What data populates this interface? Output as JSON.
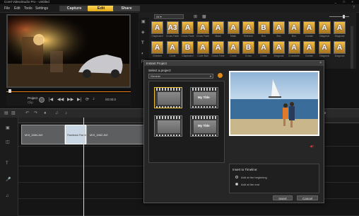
{
  "window": {
    "title": "Corel VideoStudio Pro - Untitled",
    "controls": "_ □ ×"
  },
  "menu": {
    "items": [
      "File",
      "Edit",
      "Tools",
      "Settings"
    ]
  },
  "steps": {
    "capture": "Capture",
    "edit": "Edit",
    "share": "Share"
  },
  "preview": {
    "project_label": "Project",
    "clip_label": "Clip",
    "timecode": "00:00:0"
  },
  "library": {
    "filter": "All",
    "thumbs": [
      {
        "label": "Clapboard",
        "glyph": "A"
      },
      {
        "label": "Cross Fade",
        "glyph": "A3"
      },
      {
        "label": "Cross Fade",
        "glyph": "A"
      },
      {
        "label": "Cross Fade",
        "glyph": "A"
      },
      {
        "label": "Mask",
        "glyph": "A"
      },
      {
        "label": "Mask",
        "glyph": "A"
      },
      {
        "label": "Retrieve",
        "glyph": "A"
      },
      {
        "label": "Box",
        "glyph": "B"
      },
      {
        "label": "Box",
        "glyph": "A"
      },
      {
        "label": "Box",
        "glyph": "A"
      },
      {
        "label": "Curtain",
        "glyph": "A"
      },
      {
        "label": "Diagonal",
        "glyph": "A"
      },
      {
        "label": "Diagonal",
        "glyph": "A"
      },
      {
        "label": "Checker",
        "glyph": "A"
      },
      {
        "label": "Circle",
        "glyph": "A"
      },
      {
        "label": "Clapboard",
        "glyph": "B"
      },
      {
        "label": "Cube Ball",
        "glyph": "A"
      },
      {
        "label": "Cross Fade",
        "glyph": "A"
      },
      {
        "label": "Cross",
        "glyph": "A"
      },
      {
        "label": "Cross",
        "glyph": "B"
      },
      {
        "label": "Cross",
        "glyph": "A"
      },
      {
        "label": "Diagonal",
        "glyph": "A"
      },
      {
        "label": "Crossfade",
        "glyph": "A"
      },
      {
        "label": "Curtain",
        "glyph": "A"
      },
      {
        "label": "Diagonal",
        "glyph": "A"
      },
      {
        "label": "Diagonal",
        "glyph": "A"
      },
      {
        "label": "",
        "glyph": "A"
      },
      {
        "label": "",
        "glyph": "B"
      },
      {
        "label": "",
        "glyph": "A"
      }
    ]
  },
  "timeline": {
    "timecode": "0:00:23:19",
    "clips": [
      {
        "name": "MVI_1664.AVI"
      },
      {
        "name": "Flashback Flashback"
      },
      {
        "name": "MVI_1662.AVI"
      }
    ]
  },
  "dialog": {
    "title": "Instant Project",
    "select_label": "Select a project:",
    "category": "Generic",
    "templates": [
      {
        "caption": ""
      },
      {
        "caption": "My Title"
      },
      {
        "caption": ""
      },
      {
        "caption": "My Title"
      }
    ],
    "insert_label": "Insert to Timeline:",
    "options": [
      {
        "label": "Add at the beginning",
        "selected": false
      },
      {
        "label": "Add at the end",
        "selected": true
      }
    ],
    "insert_button": "Insert",
    "cancel_button": "Cancel"
  },
  "colors": {
    "accent": "#f0b429",
    "progress": "#e27a14"
  }
}
